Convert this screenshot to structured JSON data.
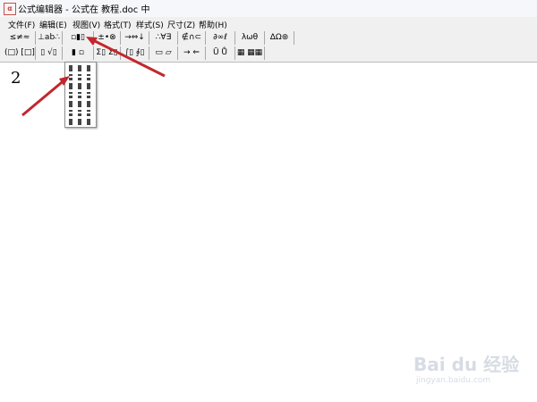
{
  "window": {
    "title": "公式编辑器 - 公式在 教程.doc 中",
    "icon": "app-icon-equation",
    "icon_text": "α"
  },
  "menu": [
    "文件(F)",
    "编辑(E)",
    "视图(V)",
    "格式(T)",
    "样式(S)",
    "尺寸(Z)",
    "帮助(H)"
  ],
  "toolbar": {
    "row1": [
      "≤≠≈",
      "⊥ab∴",
      "▫▮▯",
      "±•⊗",
      "→⇔↓",
      "∴∀∃",
      "∉∩⊂",
      "∂∞ℓ",
      "λωθ",
      "ΔΩ⊛"
    ],
    "row2": [
      "(□) [□]",
      "▯ √▯",
      "▮ ▫",
      "Σ▯ Σ▯",
      "∫▯ ∮▯",
      "▭ ▱",
      "→ ⇐",
      "Ū Ů",
      "▦ ▦▦"
    ]
  },
  "editor": {
    "expression": "2"
  },
  "palette": {
    "visible": true
  },
  "watermark": {
    "text": "Bai du 经验",
    "sub": "jingyan.baidu.com"
  },
  "annotation": {
    "arrow_color": "#c3262e"
  }
}
